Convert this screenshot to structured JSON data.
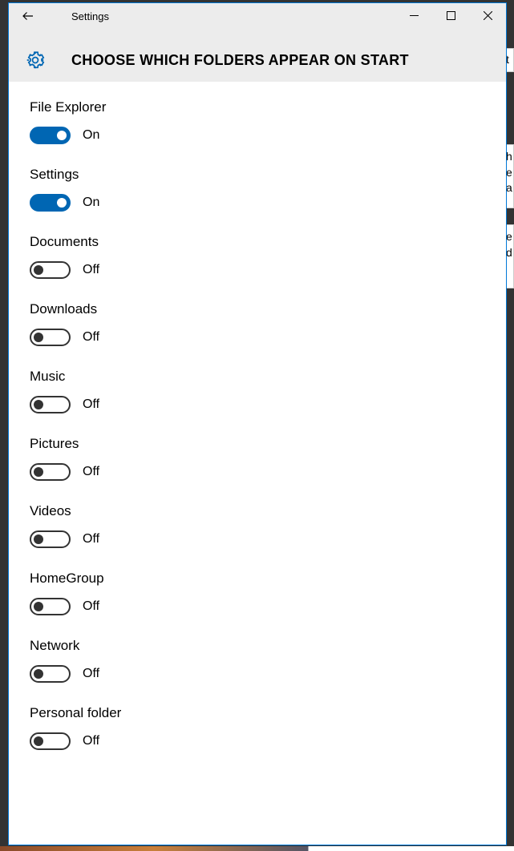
{
  "window": {
    "title": "Settings"
  },
  "page": {
    "heading": "CHOOSE WHICH FOLDERS APPEAR ON START"
  },
  "toggle_labels": {
    "on": "On",
    "off": "Off"
  },
  "settings": [
    {
      "key": "file-explorer",
      "label": "File Explorer",
      "on": true
    },
    {
      "key": "settings",
      "label": "Settings",
      "on": true
    },
    {
      "key": "documents",
      "label": "Documents",
      "on": false
    },
    {
      "key": "downloads",
      "label": "Downloads",
      "on": false
    },
    {
      "key": "music",
      "label": "Music",
      "on": false
    },
    {
      "key": "pictures",
      "label": "Pictures",
      "on": false
    },
    {
      "key": "videos",
      "label": "Videos",
      "on": false
    },
    {
      "key": "homegroup",
      "label": "HomeGroup",
      "on": false
    },
    {
      "key": "network",
      "label": "Network",
      "on": false
    },
    {
      "key": "personal-folder",
      "label": "Personal folder",
      "on": false
    }
  ],
  "background_fragments": {
    "f1": "t",
    "f2": "h\ne\na",
    "f3": "e\nd"
  }
}
